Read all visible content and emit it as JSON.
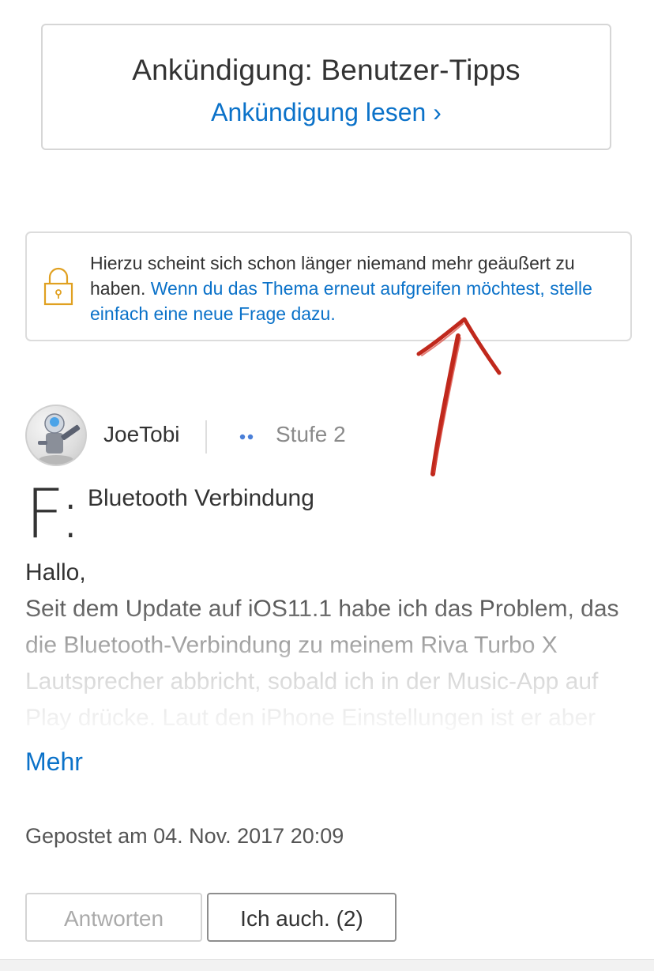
{
  "announcement": {
    "title": "Ankündigung: Benutzer-Tipps",
    "link": "Ankündigung lesen ›"
  },
  "notice": {
    "icon": "lock-icon",
    "text": "Hierzu scheint sich schon länger niemand mehr geäußert zu haben.",
    "link": "Wenn du das Thema erneut aufgreifen möchtest, stelle einfach eine neue Frage dazu."
  },
  "author": {
    "name": "JoeTobi",
    "level": "Stufe 2"
  },
  "question": {
    "letter": "F:",
    "title": "Bluetooth Verbindung",
    "greeting": "Hallo,",
    "body": "Seit dem Update auf iOS11.1 habe ich das Problem, das die Bluetooth-Verbindung zu meinem Riva Turbo X Lautsprecher abbricht, sobald ich in der Music-App auf Play drücke. Laut den iPhone Einstellungen ist er aber noch verbunden. Ich stelle",
    "more": "Mehr",
    "posted": "Gepostet am 04. Nov. 2017 20:09"
  },
  "actions": {
    "reply": "Antworten",
    "me_too": "Ich auch. (2)"
  },
  "colors": {
    "link": "#0b72c9",
    "lock": "#e0a020",
    "level_dots": "#4a7fd8",
    "annotation_arrow": "#c0281c"
  }
}
